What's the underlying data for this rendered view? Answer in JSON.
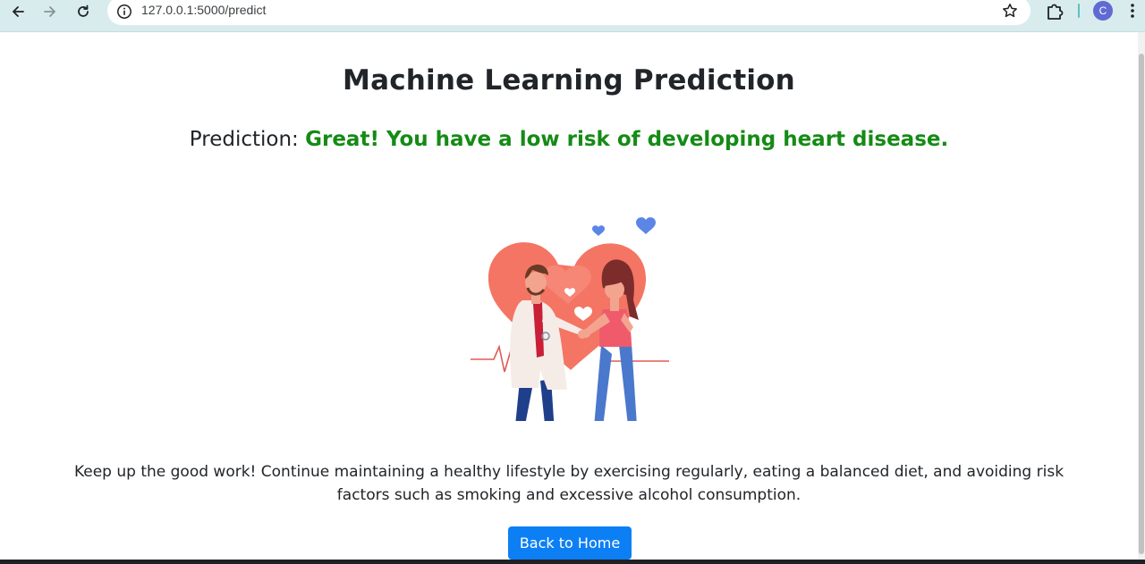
{
  "browser": {
    "url": "127.0.0.1:5000/predict",
    "profile_initial": "C"
  },
  "page": {
    "title": "Machine Learning Prediction",
    "prediction_label": "Prediction:",
    "prediction_result": "Great! You have a low risk of developing heart disease.",
    "message": "Keep up the good work! Continue maintaining a healthy lifestyle by exercising regularly, eating a balanced diet, and avoiding risk factors such as smoking and excessive alcohol consumption.",
    "button_label": "Back to Home"
  },
  "colors": {
    "result_green": "#158b15",
    "button_blue": "#0d7ff5",
    "heart": "#f47563",
    "chrome_bg": "#d8ecee"
  },
  "icons": [
    "back-arrow-icon",
    "forward-arrow-icon",
    "reload-icon",
    "site-info-icon",
    "bookmark-star-icon",
    "extensions-icon",
    "menu-icon"
  ]
}
